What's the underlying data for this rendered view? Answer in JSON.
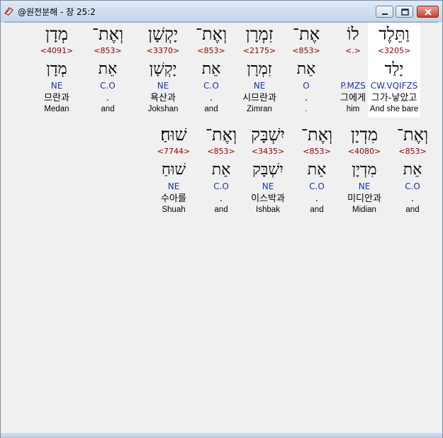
{
  "window": {
    "title": "@원전분해 - 창 25:2",
    "minimize_label": "minimize",
    "maximize_label": "maximize",
    "close_label": "close"
  },
  "rows": [
    {
      "words": [
        {
          "hebrew": "וַתֵּלֶד",
          "strong": "<3205>",
          "lemma": "יָלַד",
          "morph": "CW.VQIFZS",
          "korean": "그가-낳았고",
          "english": "And she bare",
          "highlight": true
        },
        {
          "hebrew": "לוֹ",
          "strong": "<.>",
          "lemma": "",
          "morph": "P.MZS",
          "korean": "그에게",
          "english": "him",
          "highlight": false
        },
        {
          "hebrew": "אֶת־",
          "strong": "<853>",
          "lemma": "אֵת",
          "morph": "O",
          "korean": ".",
          "english": ".",
          "highlight": false
        },
        {
          "hebrew": "זִמְרָן",
          "strong": "<2175>",
          "lemma": "זִמְרָן",
          "morph": "NE",
          "korean": "시므란과",
          "english": "Zimran",
          "highlight": false
        },
        {
          "hebrew": "וְאֶת־",
          "strong": "<853>",
          "lemma": "אֵת",
          "morph": "C.O",
          "korean": ".",
          "english": "and",
          "highlight": false
        },
        {
          "hebrew": "יָקְשָׁן",
          "strong": "<3370>",
          "lemma": "יָקְשָׁן",
          "morph": "NE",
          "korean": "욕산과",
          "english": "Jokshan",
          "highlight": false
        },
        {
          "hebrew": "וְאֶת־",
          "strong": "<853>",
          "lemma": "אֵת",
          "morph": "C.O",
          "korean": ".",
          "english": "and",
          "highlight": false
        },
        {
          "hebrew": "מְדָן",
          "strong": "<4091>",
          "lemma": "מְדָן",
          "morph": "NE",
          "korean": "므란과",
          "english": "Medan",
          "highlight": false
        }
      ]
    },
    {
      "words": [
        {
          "hebrew": "וְאֶת־",
          "strong": "<853>",
          "lemma": "אֵת",
          "morph": "C.O",
          "korean": ".",
          "english": "and",
          "highlight": false
        },
        {
          "hebrew": "מִדְיָן",
          "strong": "<4080>",
          "lemma": "מִדְיָן",
          "morph": "NE",
          "korean": "미디안과",
          "english": "Midian",
          "highlight": false
        },
        {
          "hebrew": "וְאֶת־",
          "strong": "<853>",
          "lemma": "אֵת",
          "morph": "C.O",
          "korean": ".",
          "english": "and",
          "highlight": false
        },
        {
          "hebrew": "יִשְׁבָּק",
          "strong": "<3435>",
          "lemma": "יִשְׁבָּק",
          "morph": "NE",
          "korean": "이스박과",
          "english": "Ishbak",
          "highlight": false
        },
        {
          "hebrew": "וְאֶת־",
          "strong": "<853>",
          "lemma": "אֵת",
          "morph": "C.O",
          "korean": ".",
          "english": "and",
          "highlight": false
        },
        {
          "hebrew": "שׁוּחַ׃",
          "strong": "<7744>",
          "lemma": "שׁוּחַ",
          "morph": "NE",
          "korean": "수아를",
          "english": "Shuah",
          "highlight": false
        }
      ]
    }
  ]
}
